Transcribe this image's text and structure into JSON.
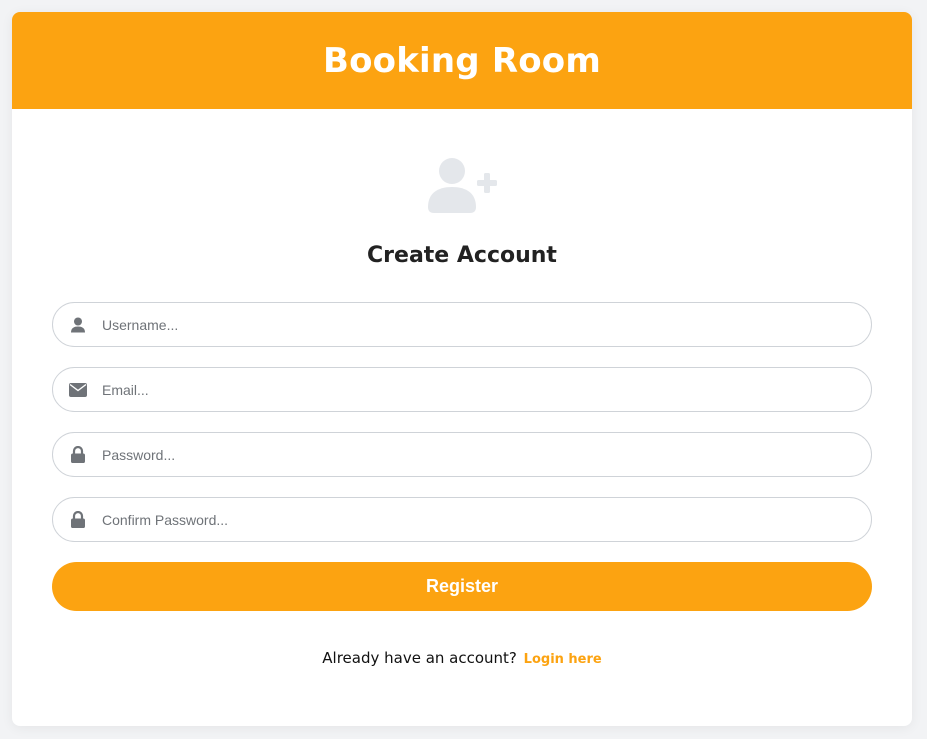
{
  "app": {
    "title": "Booking Room"
  },
  "form": {
    "heading": "Create Account",
    "avatar_icon": "user-plus-icon",
    "fields": [
      {
        "name": "username",
        "icon": "user-icon",
        "placeholder": "Username...",
        "value": ""
      },
      {
        "name": "email",
        "icon": "envelope-icon",
        "placeholder": "Email...",
        "value": ""
      },
      {
        "name": "password",
        "icon": "lock-icon",
        "placeholder": "Password...",
        "value": ""
      },
      {
        "name": "confirm_password",
        "icon": "lock-icon",
        "placeholder": "Confirm Password...",
        "value": ""
      }
    ],
    "submit_label": "Register"
  },
  "footer": {
    "prompt": "Already have an account?",
    "link_label": "Login here"
  },
  "colors": {
    "accent": "#fca311",
    "icon": "#6f7378",
    "avatar": "#e4e7eb"
  }
}
